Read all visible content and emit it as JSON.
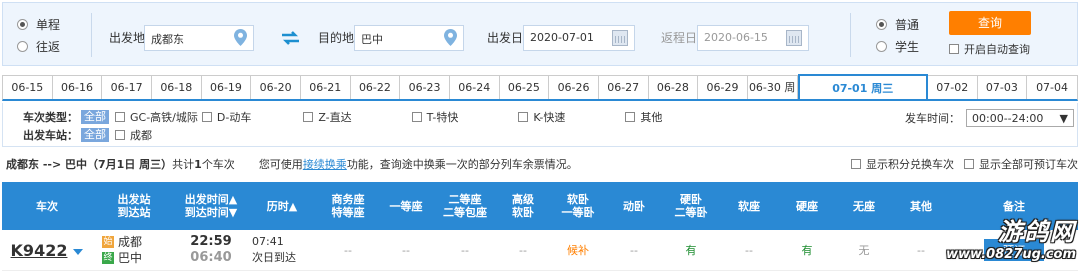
{
  "search": {
    "trip_type": [
      "单程",
      "往返"
    ],
    "from_label": "出发地",
    "from_value": "成都东",
    "to_label": "目的地",
    "to_value": "巴中",
    "depart_label": "出发日",
    "depart_value": "2020-07-01",
    "return_label": "返程日",
    "return_value": "2020-06-15",
    "passenger_type": [
      "普通",
      "学生"
    ],
    "query_button": "查询",
    "auto_query": "开启自动查询"
  },
  "date_tabs": [
    "06-15",
    "06-16",
    "06-17",
    "06-18",
    "06-19",
    "06-20",
    "06-21",
    "06-22",
    "06-23",
    "06-24",
    "06-25",
    "06-26",
    "06-27",
    "06-28",
    "06-29",
    "06-30 周",
    "07-01 周三",
    "07-02",
    "07-03",
    "07-04"
  ],
  "filters": {
    "type_label": "车次类型：",
    "all": "全部",
    "types": [
      "GC-高铁/城际",
      "D-动车",
      "Z-直达",
      "T-特快",
      "K-快速",
      "其他"
    ],
    "station_label": "出发车站：",
    "stations": [
      "成都"
    ],
    "time_label": "发车时间：",
    "time_value": "00:00--24:00"
  },
  "result": {
    "title": "成都东 --> 巴中（7月1日 周三）",
    "count_pre": "共计",
    "count": "1",
    "count_post": "个车次",
    "tip_pre": "您可使用",
    "tip_link": "接续换乘",
    "tip_post": "功能，查询途中换乘一次的部分列车余票情况。",
    "opt1": "显示积分兑换车次",
    "opt2": "显示全部可预订车次"
  },
  "columns": [
    "车次",
    "出发站\n到达站",
    "出发时间▲\n到达时间▼",
    "历时▲",
    "商务座\n特等座",
    "一等座",
    "二等座\n二等包座",
    "高级\n软卧",
    "软卧\n一等卧",
    "动卧",
    "硬卧\n二等卧",
    "软座",
    "硬座",
    "无座",
    "其他",
    "备注"
  ],
  "train": {
    "number": "K9422",
    "from_tag": "始",
    "from": "成都",
    "to_tag": "终",
    "to": "巴中",
    "depart": "22:59",
    "arrive": "06:40",
    "duration": "07:41",
    "duration_note": "次日到达",
    "seats": [
      "--",
      "--",
      "--",
      "--",
      "候补",
      "--",
      "有",
      "--",
      "有",
      "无",
      "--"
    ],
    "book": "预订"
  },
  "watermark": {
    "line1": "游鸽网",
    "line2": "www.0827ug.com"
  },
  "colors": {
    "accent": "#2a89d4",
    "query": "#ff7f00",
    "available": "#1c8c2e"
  }
}
